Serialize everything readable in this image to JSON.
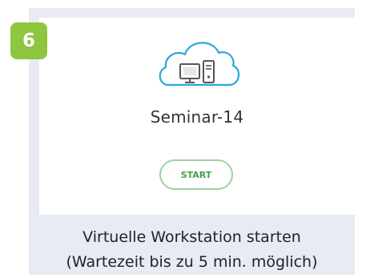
{
  "step": {
    "number": "6",
    "badge_color": "#8ec63f"
  },
  "workstation": {
    "icon": "cloud-computer-icon",
    "icon_color": "#29a8df",
    "name": "Seminar-14",
    "start_label": "START",
    "start_color": "#3fa34d"
  },
  "caption": {
    "line1": "Virtuelle Workstation starten",
    "line2": "(Wartezeit bis zu 5 min. möglich)"
  }
}
